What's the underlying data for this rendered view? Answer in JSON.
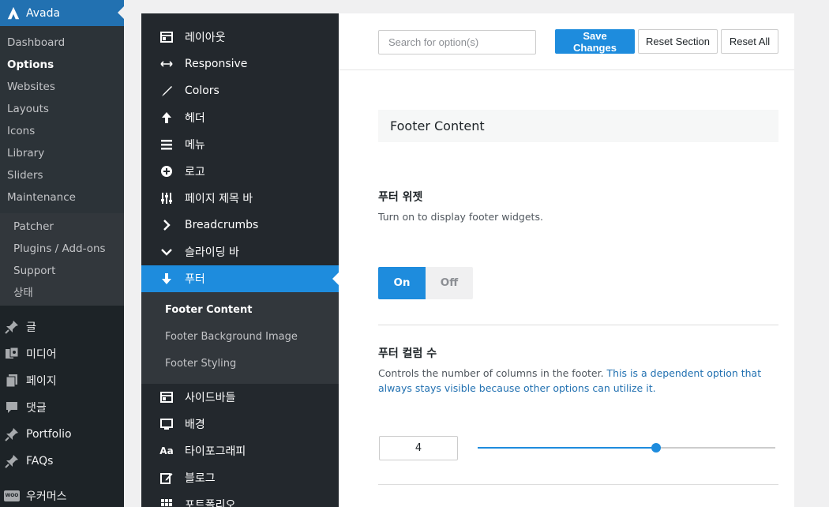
{
  "wp_admin": {
    "brand": "Avada",
    "submenu": [
      "Dashboard",
      "Options",
      "Websites",
      "Layouts",
      "Icons",
      "Library",
      "Sliders",
      "Maintenance"
    ],
    "submenu_current": "Options",
    "submenu2": [
      "Patcher",
      "Plugins / Add-ons",
      "Support",
      "상태"
    ],
    "main": [
      {
        "label": "글",
        "icon": "pin-icon"
      },
      {
        "label": "미디어",
        "icon": "media-icon"
      },
      {
        "label": "페이지",
        "icon": "page-icon"
      },
      {
        "label": "댓글",
        "icon": "comment-icon"
      },
      {
        "label": "Portfolio",
        "icon": "pin-icon"
      },
      {
        "label": "FAQs",
        "icon": "pin-icon"
      },
      {
        "label": "우커머스",
        "icon": "woo-icon",
        "badge": "WOO"
      }
    ]
  },
  "options_nav": {
    "items_top": [
      {
        "label": "레이아웃",
        "icon": "layout-icon"
      },
      {
        "label": "Responsive",
        "icon": "arrows-horizontal-icon"
      },
      {
        "label": "Colors",
        "icon": "brush-icon"
      },
      {
        "label": "헤더",
        "icon": "arrow-up-icon"
      },
      {
        "label": "메뉴",
        "icon": "menu-icon"
      },
      {
        "label": "로고",
        "icon": "plus-circle-icon"
      },
      {
        "label": "페이지 제목 바",
        "icon": "sliders-icon"
      },
      {
        "label": "Breadcrumbs",
        "icon": "chevron-right-icon"
      },
      {
        "label": "슬라이딩 바",
        "icon": "chevron-down-icon"
      }
    ],
    "active": {
      "label": "푸터",
      "icon": "arrow-down-icon"
    },
    "sub_items": [
      "Footer Content",
      "Footer Background Image",
      "Footer Styling"
    ],
    "sub_current": "Footer Content",
    "items_bottom": [
      {
        "label": "사이드바들",
        "icon": "layout-icon"
      },
      {
        "label": "배경",
        "icon": "monitor-icon"
      },
      {
        "label": "타이포그래피",
        "icon": "typography-icon",
        "glyph": "Aa"
      },
      {
        "label": "블로그",
        "icon": "edit-icon"
      },
      {
        "label": "포트폴리오",
        "icon": "grid-icon"
      }
    ]
  },
  "toolbar": {
    "search_placeholder": "Search for option(s)",
    "save_label": "Save Changes",
    "reset_section_label": "Reset Section",
    "reset_all_label": "Reset All"
  },
  "section": {
    "title": "Footer Content",
    "fields": {
      "footer_widgets": {
        "title": "푸터 위젯",
        "desc": "Turn on to display footer widgets.",
        "on_label": "On",
        "off_label": "Off",
        "value": "On"
      },
      "footer_columns": {
        "title": "푸터 컬럼 수",
        "desc": "Controls the number of columns in the footer.",
        "desc_dependent": "This is a dependent option that always stays visible because other options can utilize it.",
        "value": "4",
        "min": 1,
        "max": 6
      }
    }
  },
  "colors": {
    "accent": "#1e8cdd",
    "wp_blue": "#2271b1",
    "nav_bg": "#23282d"
  }
}
